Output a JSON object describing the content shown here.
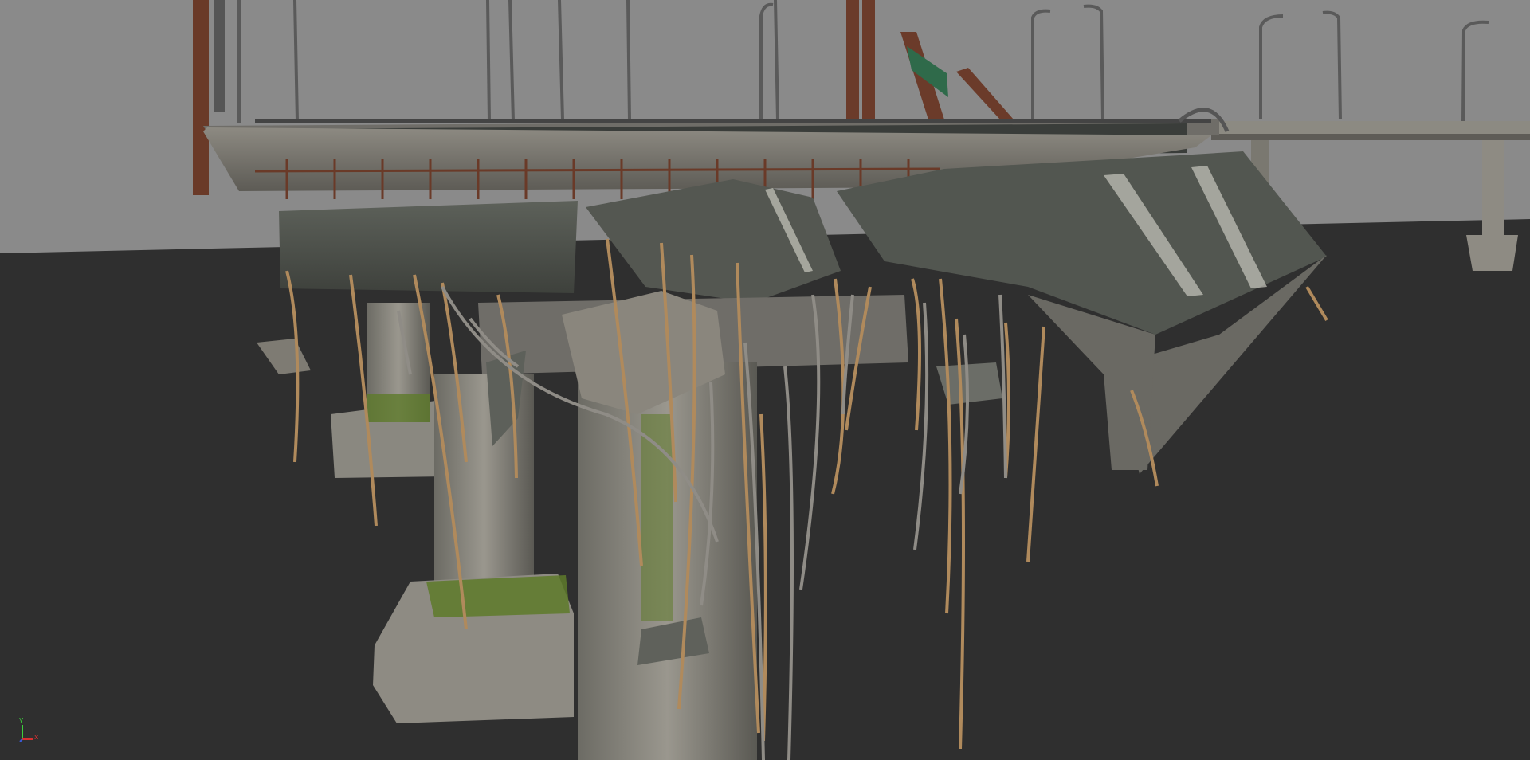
{
  "viewport": {
    "background_sky": "#8a8a8a",
    "background_ground": "#2f2f2f"
  },
  "axis_gizmo": {
    "x_label": "x",
    "y_label": "y",
    "x_color": "#d83030",
    "y_color": "#3ccf3c",
    "z_color": "#3a5bd9"
  },
  "colors": {
    "concrete": "#6f6d68",
    "concrete_dark": "#4c4d49",
    "asphalt": "#3a3d3a",
    "rebar_rope": "#b08a5c",
    "rebar_metal": "#8f8c86",
    "rust": "#6a3a28",
    "moss": "#5e7a2a",
    "sign_green": "#2f6a4a"
  }
}
